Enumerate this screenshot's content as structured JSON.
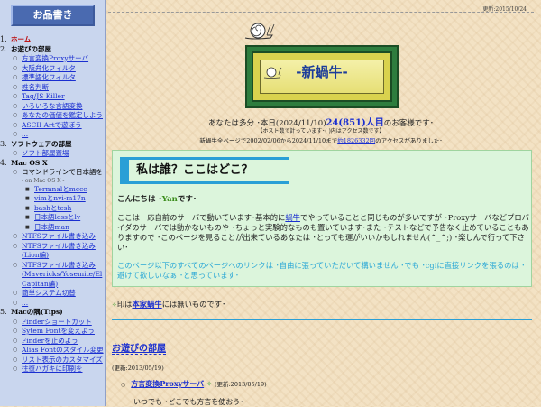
{
  "sidebar": {
    "title": "お品書き",
    "sections": [
      {
        "num": "1.",
        "label": "ホーム",
        "home": true,
        "items": []
      },
      {
        "num": "2.",
        "label": "お遊びの部屋",
        "items": [
          {
            "label": "方言変換Proxyサーバ"
          },
          {
            "label": "大阪弁化フィルタ"
          },
          {
            "label": "標準語化フィルタ"
          },
          {
            "label": "姓名判断"
          },
          {
            "label": "Tag/JS Killer"
          },
          {
            "label": "いろいろな言語変換"
          },
          {
            "label": "あなたの価値を鑑定しよう"
          },
          {
            "label": "ASCII Artで遊ぼう"
          },
          {
            "label": "..."
          }
        ]
      },
      {
        "num": "3.",
        "label": "ソフトウェアの部屋",
        "items": [
          {
            "label": "ソフト部屋置場"
          }
        ]
      },
      {
        "num": "4.",
        "label": "Mac OS X",
        "items": [
          {
            "label": "コマンドラインで日本語を",
            "note": "- on Mac OS X -",
            "sub": [
              {
                "label": "Termnalとmccc"
              },
              {
                "label": "vimとnvi-m17n"
              },
              {
                "label": "bashとtcsh"
              },
              {
                "label": "日本語lessとlv"
              },
              {
                "label": "日本語man"
              }
            ]
          },
          {
            "label": "NTFSファイル書き込み"
          },
          {
            "label": "NTFSファイル書き込み(Lion編)"
          },
          {
            "label": "NTFSファイル書き込み(Mavericks/Yosemite/El Capitan編)"
          },
          {
            "label": "簡単システム切替"
          },
          {
            "label": "..."
          }
        ]
      },
      {
        "num": "5.",
        "label": "Macの隅(Tips)",
        "items": [
          {
            "label": "Finderショートカット"
          },
          {
            "label": "Sytem Fontを変えよう"
          },
          {
            "label": "Finderを止めよう"
          },
          {
            "label": "Alias Fontのスタイル変更"
          },
          {
            "label": "リスト表示のカスタマイズ"
          },
          {
            "label": "往復ハガキに印刷を"
          }
        ]
      }
    ]
  },
  "header": {
    "updated": "更新:2015/10/24",
    "banner_title": "-新蝸牛-"
  },
  "visitors": {
    "prefix": "あなたは多分 ･本日(2024/11/10)",
    "count": "24(851)人目",
    "suffix": "のお客様です･",
    "note": "【ホスト数で計っています･( )内はアクセス数です】",
    "total_prefix": "新蝸牛全ページで2002/02/06から2024/11/10まで",
    "total_count": "約1826332回",
    "total_suffix": "のアクセスがありました･"
  },
  "info": {
    "title": "私は誰？ここはどこ？",
    "hello_prefix": "こんにちは ･",
    "hello_name": "Yan",
    "hello_suffix": "です･",
    "intro_1": "ここは一応自前のサーバで動いています･基本的に",
    "intro_link": "蝸牛",
    "intro_2": "でやっていることと同じものが多いですが ･Proxyサーバなどプロバイダのサーバでは動かないものや ･ちょっと実験的なものも置いています･また ･テストなどで予告なく止めていることもありますので ･このページを見ることが出来ているあなたは ･とっても運がいいかもしれません(^_^;) ･楽しんで行って下さい･",
    "link_note": "このページ以下のすべてのページへのリンクは ･自由に張っていただいて構いません ･でも ･cgiに直接リンクを張るのは ･避けて欲しいなぁ ･と思っています･"
  },
  "mark_note": {
    "prefix": "印は",
    "link": "本家蝸牛",
    "suffix": "には無いものです･"
  },
  "section": {
    "title": "お遊びの部屋",
    "updated": "(更新:2013/05/19)",
    "entry_link": "方言変換Proxyサーバ",
    "entry_updated": "(更新:2013/05/19)",
    "entry_desc": "いつでも ･どこでも方言を使おう･"
  },
  "colors": {
    "background": "#f3e2c4",
    "sidebar": "#c9d6ee",
    "link": "#1a2fd0",
    "info_box": "#dcf5dc",
    "accent_blue": "#2a9fd6",
    "banner_green": "#2e7d3e"
  }
}
